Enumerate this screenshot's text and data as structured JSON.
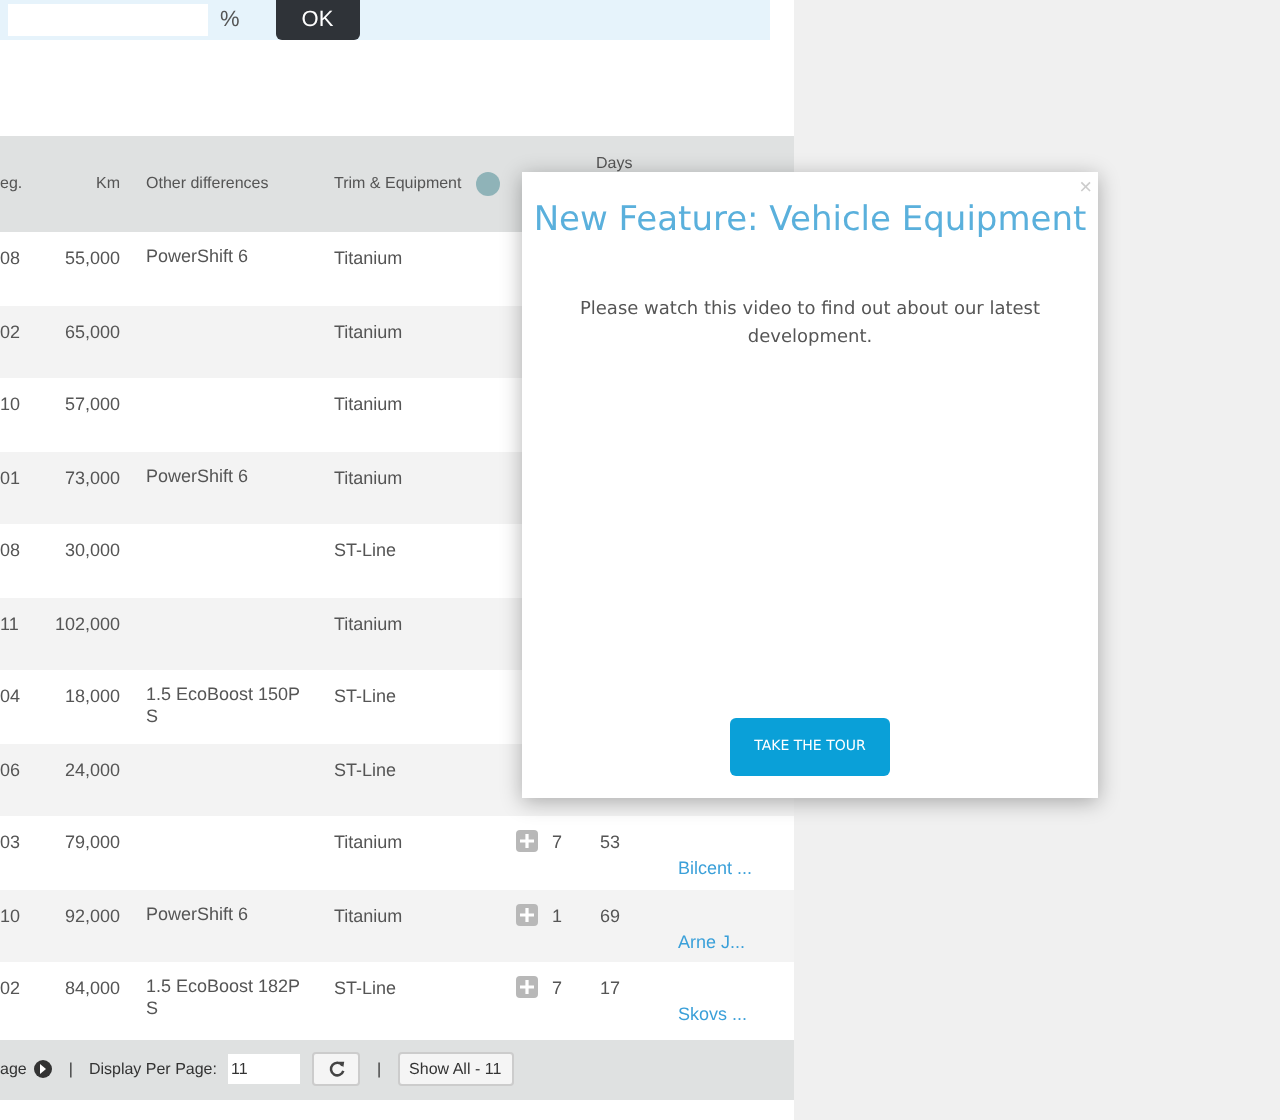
{
  "top_bar": {
    "unit": "%",
    "ok_button": "OK"
  },
  "table": {
    "columns": [
      "eg.",
      "Km",
      "Other differences",
      "Trim & Equipment",
      "Days"
    ],
    "rows": [
      {
        "reg": "08",
        "km": "55,000",
        "other": "PowerShift 6",
        "trim": "Titanium"
      },
      {
        "reg": "02",
        "km": "65,000",
        "trim": "Titanium"
      },
      {
        "reg": "10",
        "km": "57,000",
        "trim": "Titanium"
      },
      {
        "reg": "01",
        "km": "73,000",
        "other": "PowerShift 6",
        "trim": "Titanium"
      },
      {
        "reg": "08",
        "km": "30,000",
        "trim": "ST-Line"
      },
      {
        "reg": "11",
        "km": "102,000",
        "trim": "Titanium"
      },
      {
        "reg": "04",
        "km": "18,000",
        "other": "1.5 EcoBoost 150PS",
        "trim": "ST-Line"
      },
      {
        "reg": "06",
        "km": "24,000",
        "trim": "ST-Line"
      },
      {
        "reg": "03",
        "km": "79,000",
        "trim": "Titanium",
        "count": "7",
        "days": "53",
        "dealer": "Bilcent ..."
      },
      {
        "reg": "10",
        "km": "92,000",
        "other": "PowerShift 6",
        "trim": "Titanium",
        "count": "1",
        "days": "69",
        "dealer": "Arne J..."
      },
      {
        "reg": "02",
        "km": "84,000",
        "other": "1.5 EcoBoost 182PS",
        "trim": "ST-Line",
        "count": "7",
        "days": "17",
        "dealer": "Skovs ..."
      }
    ]
  },
  "pager": {
    "page_label": "age",
    "separator_1": "|",
    "per_page_label": "Display Per Page:",
    "per_page_value": "11",
    "separator_2": "|",
    "show_all": "Show All - 11"
  },
  "modal": {
    "close": "×",
    "title": "New Feature: Vehicle Equipment",
    "text": "Please watch this video to find out about our latest development.",
    "button": "TAKE THE TOUR"
  }
}
